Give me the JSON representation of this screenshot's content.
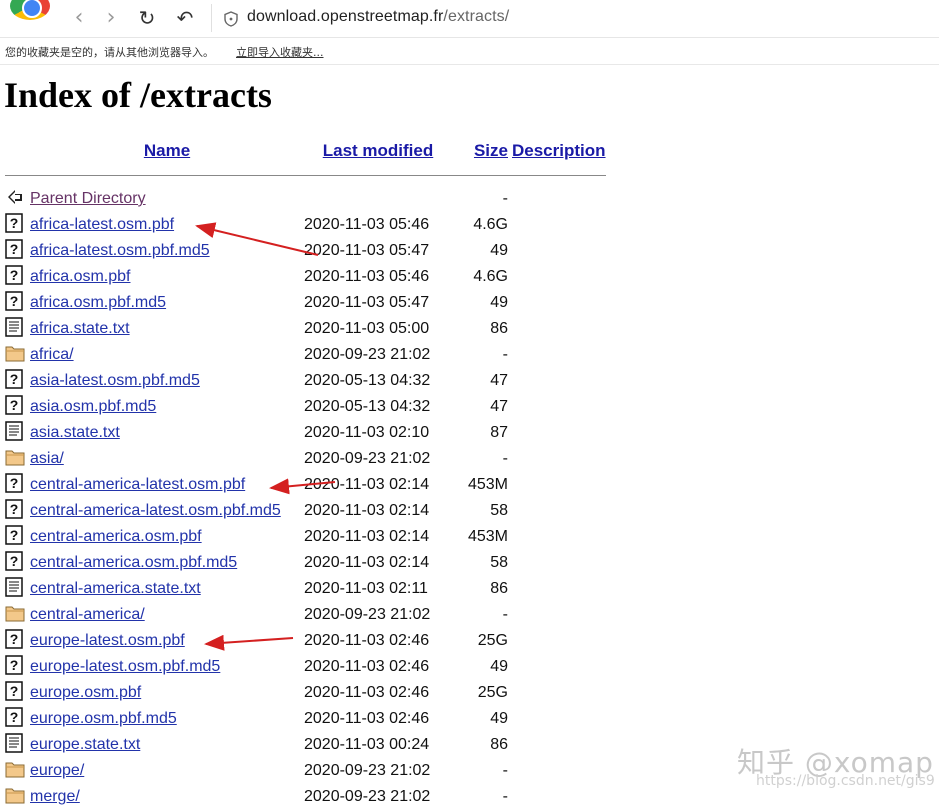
{
  "browser": {
    "url_host": "download.openstreetmap.fr",
    "url_path": "/extracts/",
    "bookmarks_message": "您的收藏夹是空的，请从其他浏览器导入。",
    "bookmarks_import_link": "立即导入收藏夹..."
  },
  "page": {
    "title": "Index of /extracts",
    "columns": {
      "name": "Name",
      "last_modified": "Last modified",
      "size": "Size",
      "description": "Description"
    },
    "rows": [
      {
        "icon": "back-icon",
        "name": "Parent Directory",
        "modified": "",
        "size": "-",
        "visited": true
      },
      {
        "icon": "unknown-file-icon",
        "name": "africa-latest.osm.pbf",
        "modified": "2020-11-03 05:46",
        "size": "4.6G"
      },
      {
        "icon": "unknown-file-icon",
        "name": "africa-latest.osm.pbf.md5",
        "modified": "2020-11-03 05:47",
        "size": "49"
      },
      {
        "icon": "unknown-file-icon",
        "name": "africa.osm.pbf",
        "modified": "2020-11-03 05:46",
        "size": "4.6G"
      },
      {
        "icon": "unknown-file-icon",
        "name": "africa.osm.pbf.md5",
        "modified": "2020-11-03 05:47",
        "size": "49"
      },
      {
        "icon": "text-file-icon",
        "name": "africa.state.txt",
        "modified": "2020-11-03 05:00",
        "size": "86"
      },
      {
        "icon": "folder-icon",
        "name": "africa/",
        "modified": "2020-09-23 21:02",
        "size": "-"
      },
      {
        "icon": "unknown-file-icon",
        "name": "asia-latest.osm.pbf.md5",
        "modified": "2020-05-13 04:32",
        "size": "47"
      },
      {
        "icon": "unknown-file-icon",
        "name": "asia.osm.pbf.md5",
        "modified": "2020-05-13 04:32",
        "size": "47"
      },
      {
        "icon": "text-file-icon",
        "name": "asia.state.txt",
        "modified": "2020-11-03 02:10",
        "size": "87"
      },
      {
        "icon": "folder-icon",
        "name": "asia/",
        "modified": "2020-09-23 21:02",
        "size": "-"
      },
      {
        "icon": "unknown-file-icon",
        "name": "central-america-latest.osm.pbf",
        "modified": "2020-11-03 02:14",
        "size": "453M"
      },
      {
        "icon": "unknown-file-icon",
        "name": "central-america-latest.osm.pbf.md5",
        "modified": "2020-11-03 02:14",
        "size": "58"
      },
      {
        "icon": "unknown-file-icon",
        "name": "central-america.osm.pbf",
        "modified": "2020-11-03 02:14",
        "size": "453M"
      },
      {
        "icon": "unknown-file-icon",
        "name": "central-america.osm.pbf.md5",
        "modified": "2020-11-03 02:14",
        "size": "58"
      },
      {
        "icon": "text-file-icon",
        "name": "central-america.state.txt",
        "modified": "2020-11-03 02:11",
        "size": "86"
      },
      {
        "icon": "folder-icon",
        "name": "central-america/",
        "modified": "2020-09-23 21:02",
        "size": "-"
      },
      {
        "icon": "unknown-file-icon",
        "name": "europe-latest.osm.pbf",
        "modified": "2020-11-03 02:46",
        "size": "25G"
      },
      {
        "icon": "unknown-file-icon",
        "name": "europe-latest.osm.pbf.md5",
        "modified": "2020-11-03 02:46",
        "size": "49"
      },
      {
        "icon": "unknown-file-icon",
        "name": "europe.osm.pbf",
        "modified": "2020-11-03 02:46",
        "size": "25G"
      },
      {
        "icon": "unknown-file-icon",
        "name": "europe.osm.pbf.md5",
        "modified": "2020-11-03 02:46",
        "size": "49"
      },
      {
        "icon": "text-file-icon",
        "name": "europe.state.txt",
        "modified": "2020-11-03 00:24",
        "size": "86"
      },
      {
        "icon": "folder-icon",
        "name": "europe/",
        "modified": "2020-09-23 21:02",
        "size": "-"
      },
      {
        "icon": "folder-icon",
        "name": "merge/",
        "modified": "2020-09-23 21:02",
        "size": "-"
      }
    ]
  },
  "watermark": {
    "text": "知乎 @xomap",
    "url": "https://blog.csdn.net/gis9"
  },
  "colors": {
    "link": "#2233aa",
    "visited": "#663366",
    "arrow": "#d42020"
  }
}
